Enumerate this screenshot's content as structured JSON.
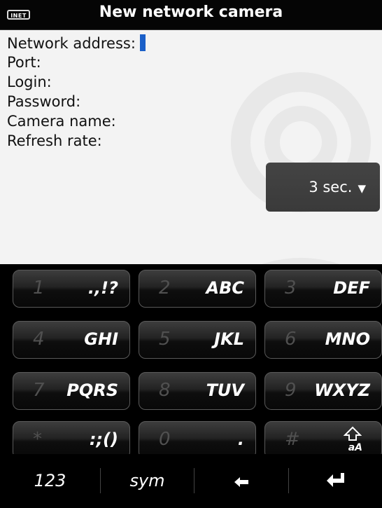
{
  "status": {
    "icon_label": "INET"
  },
  "title": "New network camera",
  "fields": {
    "network_address": "Network address:",
    "port": "Port:",
    "login": "Login:",
    "password": "Password:",
    "camera_name": "Camera name:",
    "refresh_rate": "Refresh rate:"
  },
  "refresh_dropdown": {
    "value": "3 sec."
  },
  "keys": [
    {
      "num": "1",
      "letters": ".,!?"
    },
    {
      "num": "2",
      "letters": "ABC"
    },
    {
      "num": "3",
      "letters": "DEF"
    },
    {
      "num": "4",
      "letters": "GHI"
    },
    {
      "num": "5",
      "letters": "JKL"
    },
    {
      "num": "6",
      "letters": "MNO"
    },
    {
      "num": "7",
      "letters": "PQRS"
    },
    {
      "num": "8",
      "letters": "TUV"
    },
    {
      "num": "9",
      "letters": "WXYZ"
    },
    {
      "num": "*",
      "letters": ":;()"
    },
    {
      "num": "0",
      "letters": "."
    },
    {
      "num": "#",
      "letters": ""
    }
  ],
  "shift_key_sub": "aA",
  "bottom": {
    "mode_123": "123",
    "sym": "sym"
  },
  "icons": {
    "network": "network-status-icon",
    "watermark": "camera-icon",
    "dropdown": "chevron-down-icon",
    "shift": "shift-arrow-icon",
    "backspace": "backspace-icon",
    "enter": "enter-icon"
  }
}
